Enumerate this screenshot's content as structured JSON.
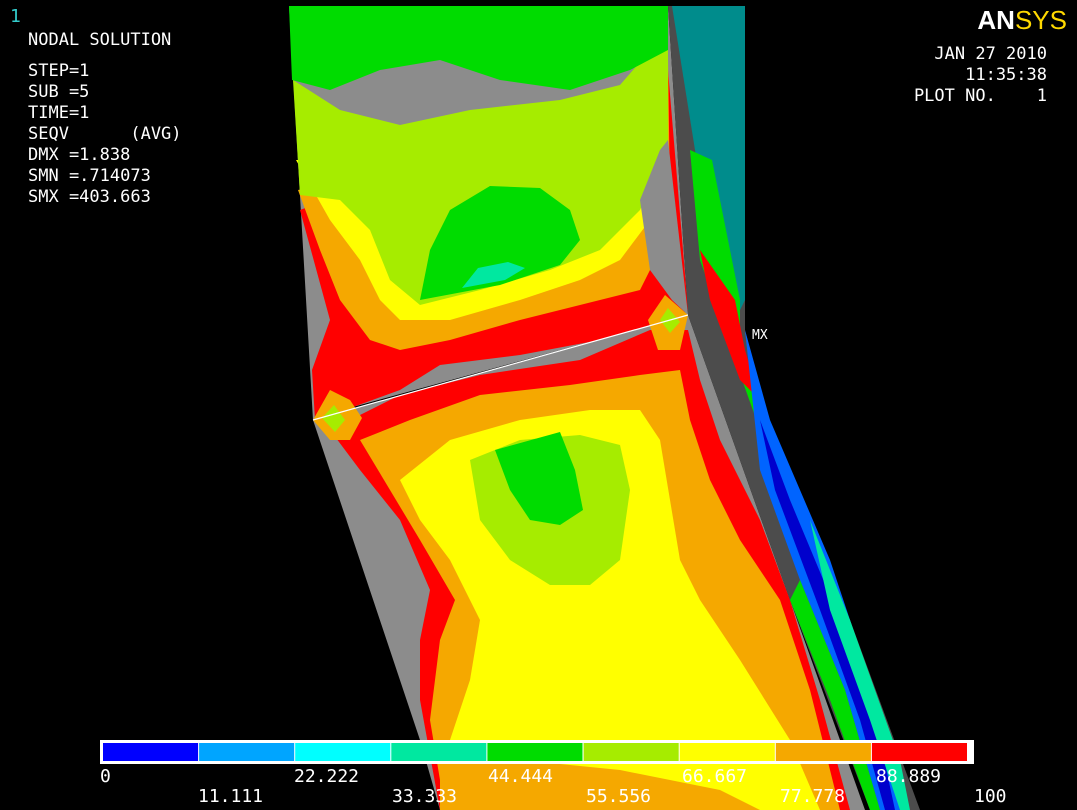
{
  "window_number": "1",
  "logo": {
    "part1": "AN",
    "part2": "SYS"
  },
  "info": {
    "title": "NODAL SOLUTION",
    "step": "STEP=1",
    "sub": "SUB =5",
    "time": "TIME=1",
    "seqv": "SEQV      (AVG)",
    "dmx": "DMX =1.838",
    "smn": "SMN =.714073",
    "smx": "SMX =403.663"
  },
  "date": {
    "date": "JAN 27 2010",
    "time": "11:35:38",
    "plot": "PLOT NO.    1"
  },
  "max_marker": "MX",
  "legend": {
    "colors": [
      "#0000ff",
      "#00a5ff",
      "#00ffff",
      "#00e8a0",
      "#00dc00",
      "#a6ec00",
      "#ffff00",
      "#f5a800",
      "#ff0000"
    ],
    "labels_top": [
      "0",
      "22.222",
      "44.444",
      "66.667",
      "88.889"
    ],
    "labels_bottom": [
      "11.111",
      "33.333",
      "55.556",
      "77.778",
      "100"
    ]
  },
  "colors": {
    "gray": "#8c8c8c",
    "dark_gray": "#4c4c4c",
    "red": "#ff0000",
    "orange": "#f5a800",
    "yellow": "#ffff00",
    "yellow_green": "#a6ec00",
    "green": "#00dc00",
    "teal": "#00e8a0",
    "dark_teal": "#008c8c"
  }
}
